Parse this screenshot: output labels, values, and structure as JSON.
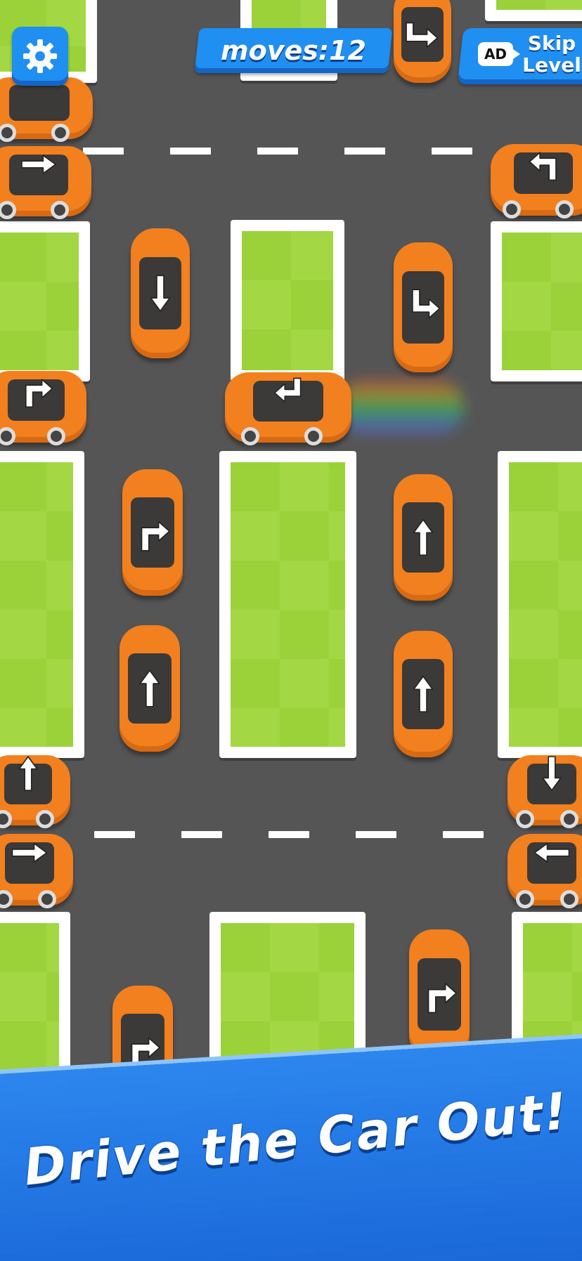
{
  "hud": {
    "moves_label": "moves:12",
    "skip_ad_badge": "AD",
    "skip_label_line1": "Skip",
    "skip_label_line2": "Level",
    "settings_icon": "gear-icon"
  },
  "banner": {
    "text": "Drive the Car Out!"
  },
  "colors": {
    "road": "#555555",
    "grass": "#9bd23a",
    "car": "#f2801e",
    "ui_blue": "#1f8ff2"
  },
  "cars": [
    {
      "name": "car-top-center",
      "dir": "v",
      "arrow": "turn-right-up"
    },
    {
      "name": "car-left-row1",
      "dir": "h",
      "arrow": "none"
    },
    {
      "name": "car-left-row2",
      "dir": "h",
      "arrow": "right"
    },
    {
      "name": "car-right-row2",
      "dir": "h",
      "arrow": "turn-left-up"
    },
    {
      "name": "car-lane1-top",
      "dir": "v",
      "arrow": "down"
    },
    {
      "name": "car-lane2-top",
      "dir": "v",
      "arrow": "turn-down-right"
    },
    {
      "name": "car-left-mid",
      "dir": "h",
      "arrow": "turn-up-right"
    },
    {
      "name": "car-moving-center",
      "dir": "h",
      "arrow": "turn-down-left"
    },
    {
      "name": "car-lane1-mid",
      "dir": "v",
      "arrow": "turn-up-right"
    },
    {
      "name": "car-lane2-mid",
      "dir": "v",
      "arrow": "up"
    },
    {
      "name": "car-lane1-low",
      "dir": "v",
      "arrow": "up"
    },
    {
      "name": "car-lane2-low",
      "dir": "v",
      "arrow": "up"
    },
    {
      "name": "car-left-bottom1",
      "dir": "h",
      "arrow": "up"
    },
    {
      "name": "car-right-bottom1",
      "dir": "h",
      "arrow": "down"
    },
    {
      "name": "car-left-bottom2",
      "dir": "h",
      "arrow": "right"
    },
    {
      "name": "car-right-bottom2",
      "dir": "h",
      "arrow": "left"
    },
    {
      "name": "car-lane2-bottom",
      "dir": "v",
      "arrow": "turn-up-right"
    },
    {
      "name": "car-lane1-bottom",
      "dir": "v",
      "arrow": "turn-up-right"
    }
  ]
}
